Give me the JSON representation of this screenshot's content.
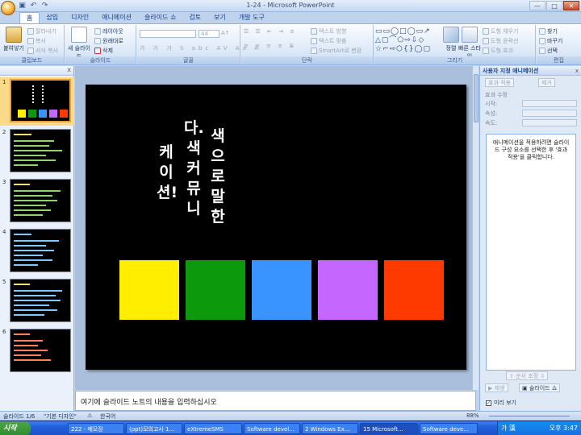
{
  "window": {
    "title": "1-24 - Microsoft PowerPoint",
    "controls": [
      "—",
      "□",
      "✕"
    ]
  },
  "ribbon_tabs": [
    "홈",
    "삽입",
    "디자인",
    "애니메이션",
    "슬라이드 쇼",
    "검토",
    "보기",
    "개발 도구"
  ],
  "ribbon": {
    "clipboard": {
      "label": "클립보드",
      "paste": "붙여넣기",
      "cut": "잘라내기",
      "copy": "복사",
      "format_painter": "서식 복사"
    },
    "slides": {
      "label": "슬라이드",
      "new_slide": "새 슬라이드",
      "layout": "레이아웃",
      "reset": "원래대로",
      "delete": "삭제"
    },
    "font": {
      "label": "글꼴",
      "size": "44"
    },
    "paragraph": {
      "label": "단락",
      "text_direction": "텍스트 방향",
      "align_text": "텍스트 맞춤",
      "smartart": "SmartArt로 변환"
    },
    "drawing": {
      "label": "그리기",
      "arrange": "정렬",
      "quick_styles": "빠른 스타일",
      "fill": "도형 채우기",
      "outline": "도형 윤곽선",
      "effects": "도형 효과"
    },
    "editing": {
      "label": "편집",
      "find": "찾기",
      "replace": "바꾸기",
      "select": "선택"
    }
  },
  "slide_panel": {
    "tabs": "",
    "close": "x",
    "thumbnails": [
      {
        "num": "1"
      },
      {
        "num": "2"
      },
      {
        "num": "3"
      },
      {
        "num": "4"
      },
      {
        "num": "5"
      },
      {
        "num": "6"
      }
    ]
  },
  "slide": {
    "columns": [
      "케이션!",
      "다.색커뮤니",
      "색으로말한"
    ],
    "squares": [
      "#ffee00",
      "#0c9a0c",
      "#3a94ff",
      "#c466ff",
      "#ff3a00"
    ]
  },
  "notes": {
    "placeholder": "여기에 슬라이드 노트의 내용을 입력하십시오"
  },
  "task_pane": {
    "title": "사용자 지정 애니메이션",
    "close": "x",
    "add_effect": "효과 적용",
    "remove": "제거",
    "modify_heading": "효과 수정",
    "start_label": "시작:",
    "property_label": "속성:",
    "speed_label": "속도:",
    "hint": "애니메이션을 적용하려면 슬라이드 구성 요소를 선택한 후 '효과 적용'을 클릭합니다.",
    "reorder": "순서 조정",
    "play": "재생",
    "slideshow": "슬라이드 쇼",
    "autopreview": "미리 보기"
  },
  "status": {
    "slide": "슬라이드 1/6",
    "theme": "\"기본 디자인\"",
    "language": "한국어",
    "zoom": "88%"
  },
  "taskbar": {
    "start": "시작",
    "tasks": [
      "222 - 메모장",
      "(ppt)모의고사 1...",
      "eXtremeSMS",
      "Software devel...",
      "2 Windows Ex...",
      "15 Microsoft...",
      "Software deve..."
    ],
    "ime": "가 漢",
    "clock": "오후 3:47"
  }
}
